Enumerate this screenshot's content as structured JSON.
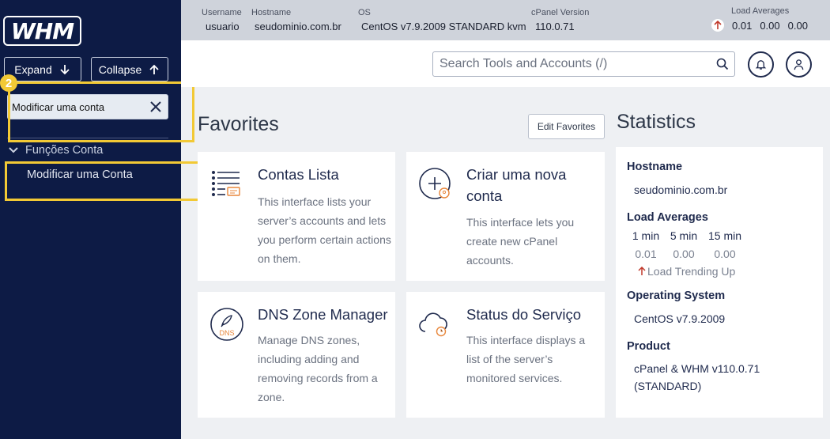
{
  "sidebar": {
    "logo_text": "WHM",
    "expand_label": "Expand",
    "collapse_label": "Collapse",
    "search_value": "Modificar uma conta",
    "group_label": "Funções Conta",
    "item_label": "Modificar uma Conta",
    "step_badge": "2"
  },
  "infobar": {
    "username_label": "Username",
    "username_value": "usuario",
    "hostname_label": "Hostname",
    "hostname_value": "seudominio.com.br",
    "os_label": "OS",
    "os_value": "CentOS v7.9.2009 STANDARD kvm",
    "cpanel_label": "cPanel Version",
    "cpanel_value": "110.0.71",
    "load_label": "Load Averages",
    "load_values": [
      "0.01",
      "0.00",
      "0.00"
    ]
  },
  "header": {
    "search_placeholder": "Search Tools and Accounts (/)"
  },
  "favorites": {
    "title": "Favorites",
    "edit_label": "Edit Favorites",
    "cards": [
      {
        "title": "Contas Lista",
        "desc": "This interface lists your server’s accounts and lets you perform certain actions on them."
      },
      {
        "title": "Criar uma nova conta",
        "desc": "This interface lets you create new cPanel accounts."
      },
      {
        "title": "DNS Zone Manager",
        "desc": "Manage DNS zones, including adding and removing records from a zone.",
        "icon_text": "DNS"
      },
      {
        "title": "Status do Serviço",
        "desc": "This interface displays a list of the server’s monitored services."
      }
    ]
  },
  "statistics": {
    "title": "Statistics",
    "hostname_label": "Hostname",
    "hostname_value": "seudominio.com.br",
    "load_label": "Load Averages",
    "load_headers": [
      "1 min",
      "5 min",
      "15 min"
    ],
    "load_values": [
      "0.01",
      "0.00",
      "0.00"
    ],
    "trend_text": "Load Trending Up",
    "os_label": "Operating System",
    "os_value": "CentOS v7.9.2009",
    "product_label": "Product",
    "product_value": "cPanel & WHM v110.0.71 (STANDARD)"
  },
  "colors": {
    "sidebar_bg": "#0d1b45",
    "highlight": "#f2c935",
    "accent_orange": "#e8863a",
    "trend_red": "#c0392b"
  }
}
